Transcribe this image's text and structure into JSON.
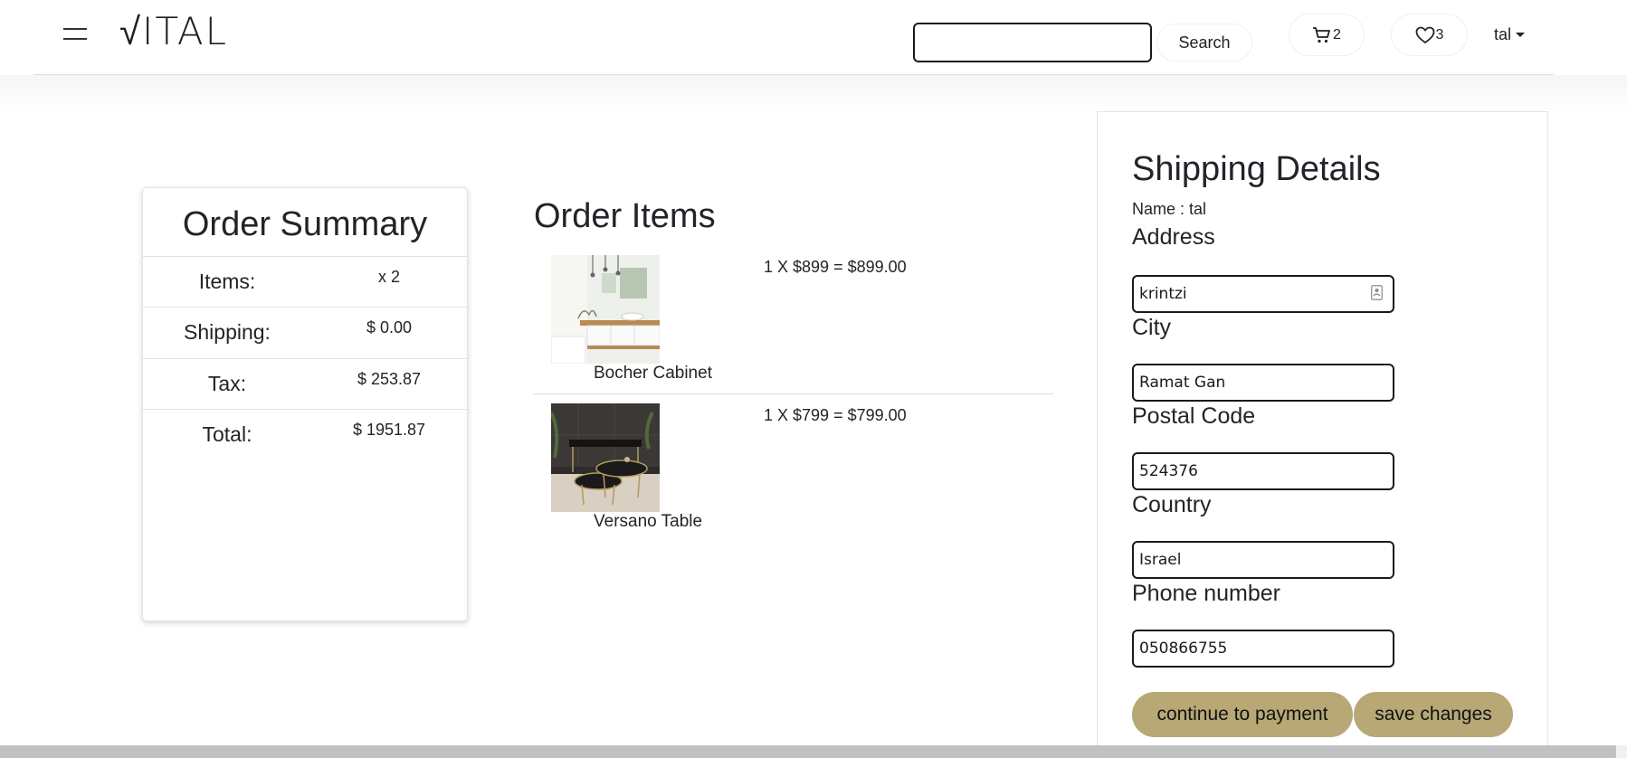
{
  "header": {
    "logo_text": "√ITAL",
    "search": {
      "value": "",
      "placeholder": "",
      "button_label": "Search"
    },
    "cart_count": "2",
    "wishlist_count": "3",
    "user_name": "tal"
  },
  "summary": {
    "title": "Order Summary",
    "rows": [
      {
        "label": "Items:",
        "value": "x 2"
      },
      {
        "label": "Shipping:",
        "value": "$ 0.00"
      },
      {
        "label": "Tax:",
        "value": "$ 253.87"
      },
      {
        "label": "Total:",
        "value": "$ 1951.87"
      }
    ]
  },
  "items": {
    "title": "Order Items",
    "list": [
      {
        "name": "Bocher Cabinet",
        "price_line": "1 X $899 = $899.00"
      },
      {
        "name": "Versano Table",
        "price_line": "1 X $799 = $799.00"
      }
    ]
  },
  "shipping": {
    "title": "Shipping Details",
    "name_line": "Name : tal",
    "fields": [
      {
        "label": "Address",
        "value": "krintzi"
      },
      {
        "label": "City",
        "value": "Ramat Gan"
      },
      {
        "label": "Postal Code",
        "value": "524376"
      },
      {
        "label": "Country",
        "value": "Israel"
      },
      {
        "label": "Phone number",
        "value": "050866755"
      }
    ],
    "continue_label": "continue to payment",
    "save_label": "save changes"
  },
  "colors": {
    "accent": "#b7a875",
    "text": "#212529",
    "border": "#e2e2e2"
  }
}
